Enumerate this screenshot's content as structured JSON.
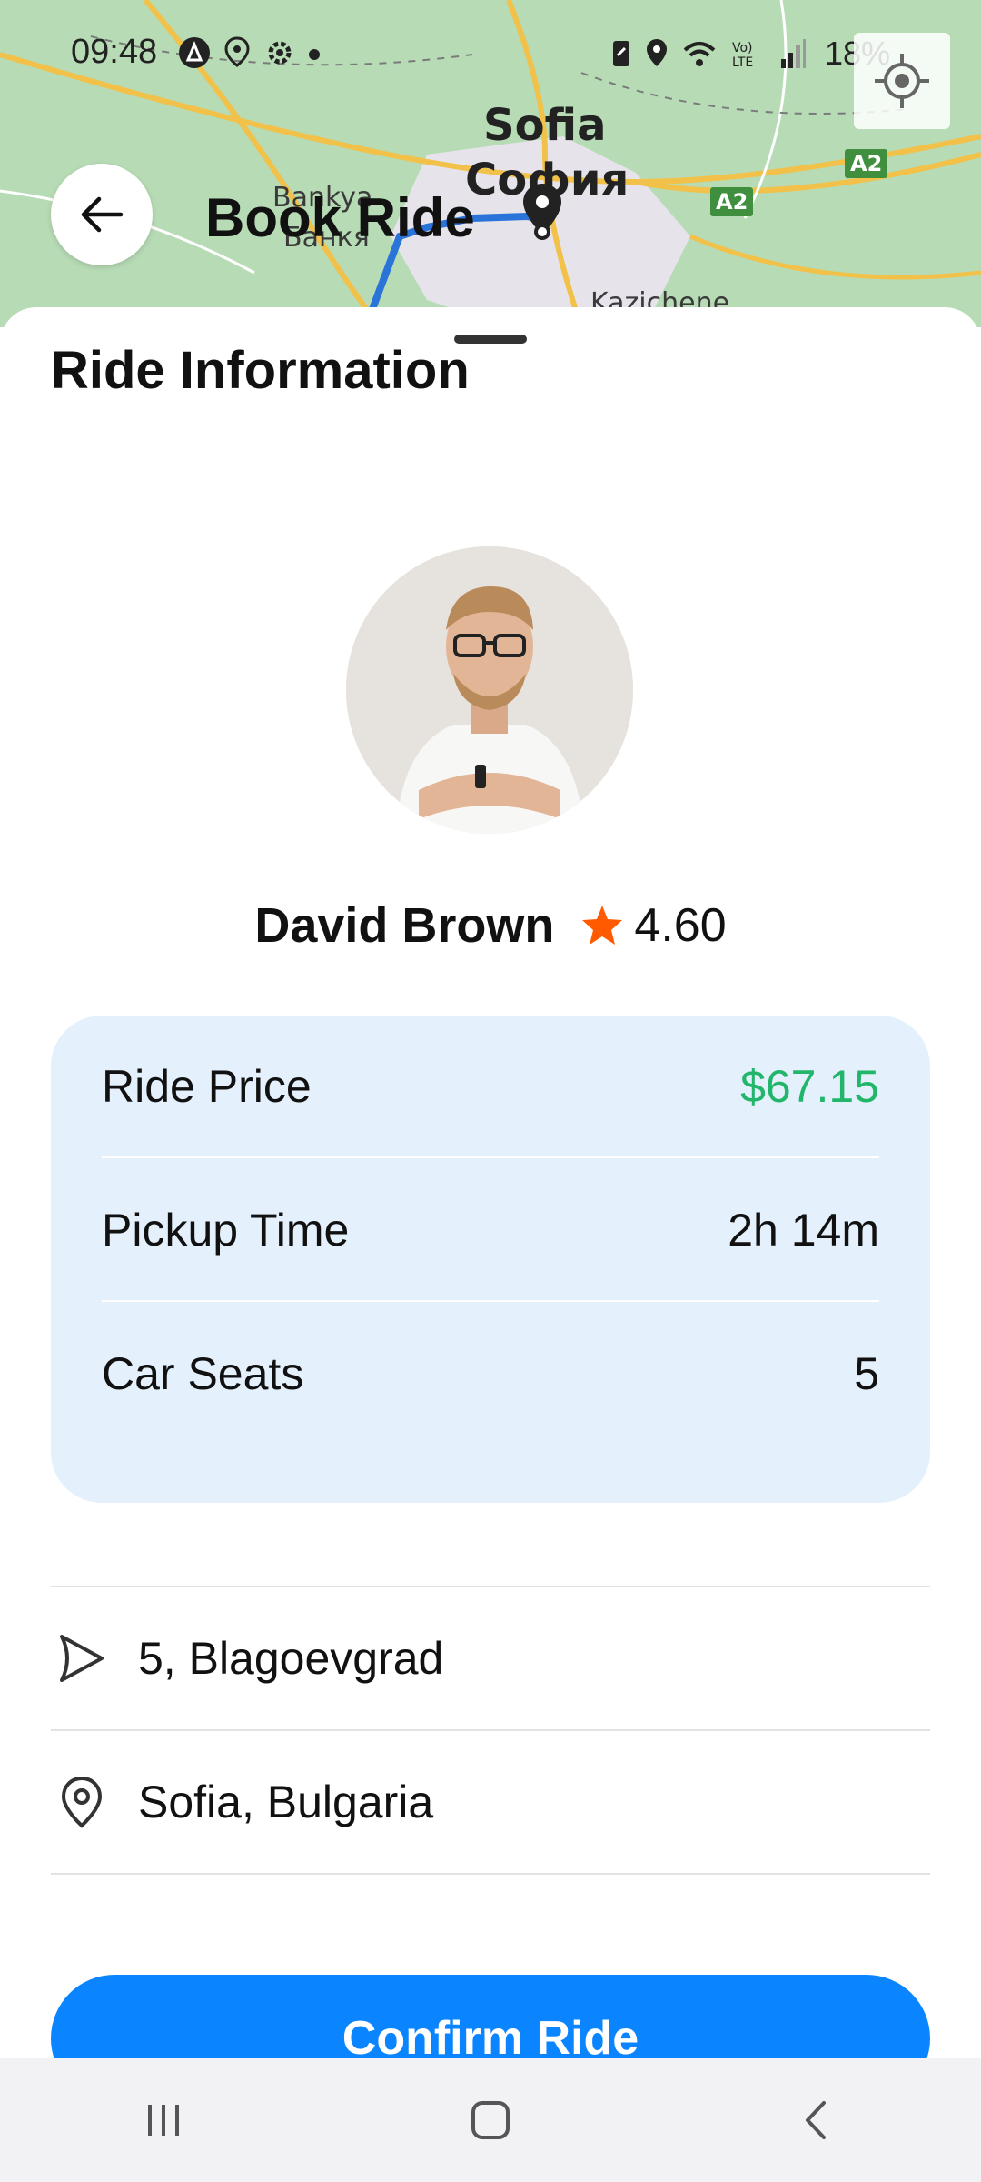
{
  "status_bar": {
    "time": "09:48",
    "battery": "18%",
    "icons": [
      "nav-app-icon",
      "location-icon",
      "settings-icon",
      "battery-saver-icon",
      "location-icon",
      "wifi-icon",
      "volte-icon",
      "signal-icon"
    ]
  },
  "map": {
    "labels": {
      "city_latin": "Sofia",
      "city_cyrillic": "София",
      "district_latin": "Bankya",
      "district_cyrillic": "Банкя",
      "district2": "Kazichene",
      "road_sign_1": "A2",
      "road_sign_2": "A2"
    }
  },
  "header": {
    "title": "Book Ride",
    "back_icon": "arrow-left-icon",
    "locate_icon": "crosshair-icon"
  },
  "sheet": {
    "title": "Ride Information",
    "driver": {
      "name": "David Brown",
      "rating": "4.60",
      "rating_icon": "star-icon",
      "rating_color": "#ff5a00"
    },
    "info": [
      {
        "label": "Ride Price",
        "value": "$67.15"
      },
      {
        "label": "Pickup Time",
        "value": "2h 14m"
      },
      {
        "label": "Car Seats",
        "value": "5"
      }
    ],
    "price_color": "#22b66a",
    "from": "5, Blagoevgrad",
    "to": "Sofia, Bulgaria",
    "confirm_label": "Confirm Ride",
    "accent_color": "#0a84ff"
  },
  "nav_bar": {
    "icons": [
      "recent-apps-icon",
      "home-icon",
      "back-icon"
    ]
  }
}
